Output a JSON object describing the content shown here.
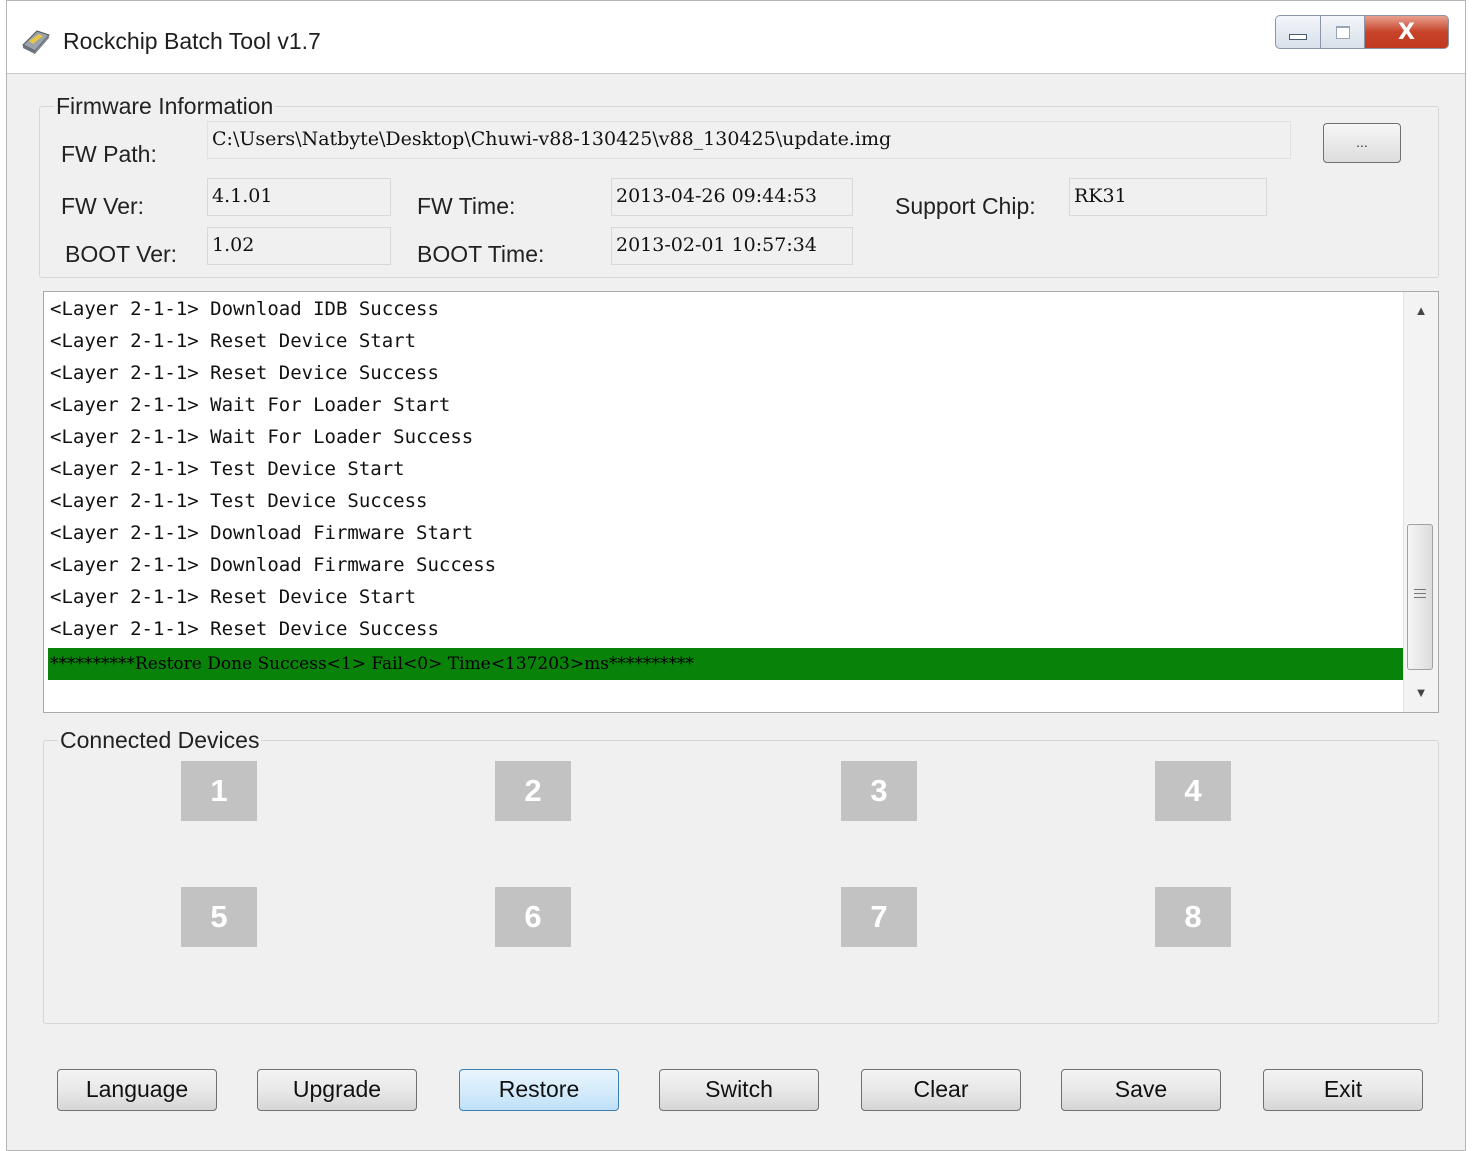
{
  "window": {
    "title": "Rockchip Batch Tool v1.7",
    "controls": {
      "minimize": "minimize-icon",
      "maximize": "maximize-icon",
      "close": "X"
    }
  },
  "firmware": {
    "group_label": "Firmware Information",
    "path_label": "FW Path:",
    "path_value": "C:\\Users\\Natbyte\\Desktop\\Chuwi-v88-130425\\v88_130425\\update.img",
    "browse_label": "...",
    "fw_ver_label": "FW Ver:",
    "fw_ver_value": "4.1.01",
    "fw_time_label": "FW Time:",
    "fw_time_value": "2013-04-26 09:44:53",
    "chip_label": "Support Chip:",
    "chip_value": "RK31",
    "boot_ver_label": "BOOT Ver:",
    "boot_ver_value": "1.02",
    "boot_time_label": "BOOT Time:",
    "boot_time_value": "2013-02-01 10:57:34"
  },
  "log": {
    "lines": [
      "<Layer 2-1-1> Download IDB Success",
      "<Layer 2-1-1> Reset Device Start",
      "<Layer 2-1-1> Reset Device Success",
      "<Layer 2-1-1> Wait For Loader Start",
      "<Layer 2-1-1> Wait For Loader Success",
      "<Layer 2-1-1> Test Device Start",
      "<Layer 2-1-1> Test Device Success",
      "<Layer 2-1-1> Download Firmware Start",
      "<Layer 2-1-1> Download Firmware Success",
      "<Layer 2-1-1> Reset Device Start",
      "<Layer 2-1-1> Reset Device Success"
    ],
    "final": "**********Restore Done Success<1> Fail<0> Time<137203>ms**********",
    "final_color": "#088208",
    "scroll_up": "▲",
    "scroll_down": "▼"
  },
  "devices": {
    "group_label": "Connected Devices",
    "slots": [
      "1",
      "2",
      "3",
      "4",
      "5",
      "6",
      "7",
      "8"
    ]
  },
  "buttons": {
    "language": "Language",
    "upgrade": "Upgrade",
    "restore": "Restore",
    "switch": "Switch",
    "clear": "Clear",
    "save": "Save",
    "exit": "Exit"
  }
}
